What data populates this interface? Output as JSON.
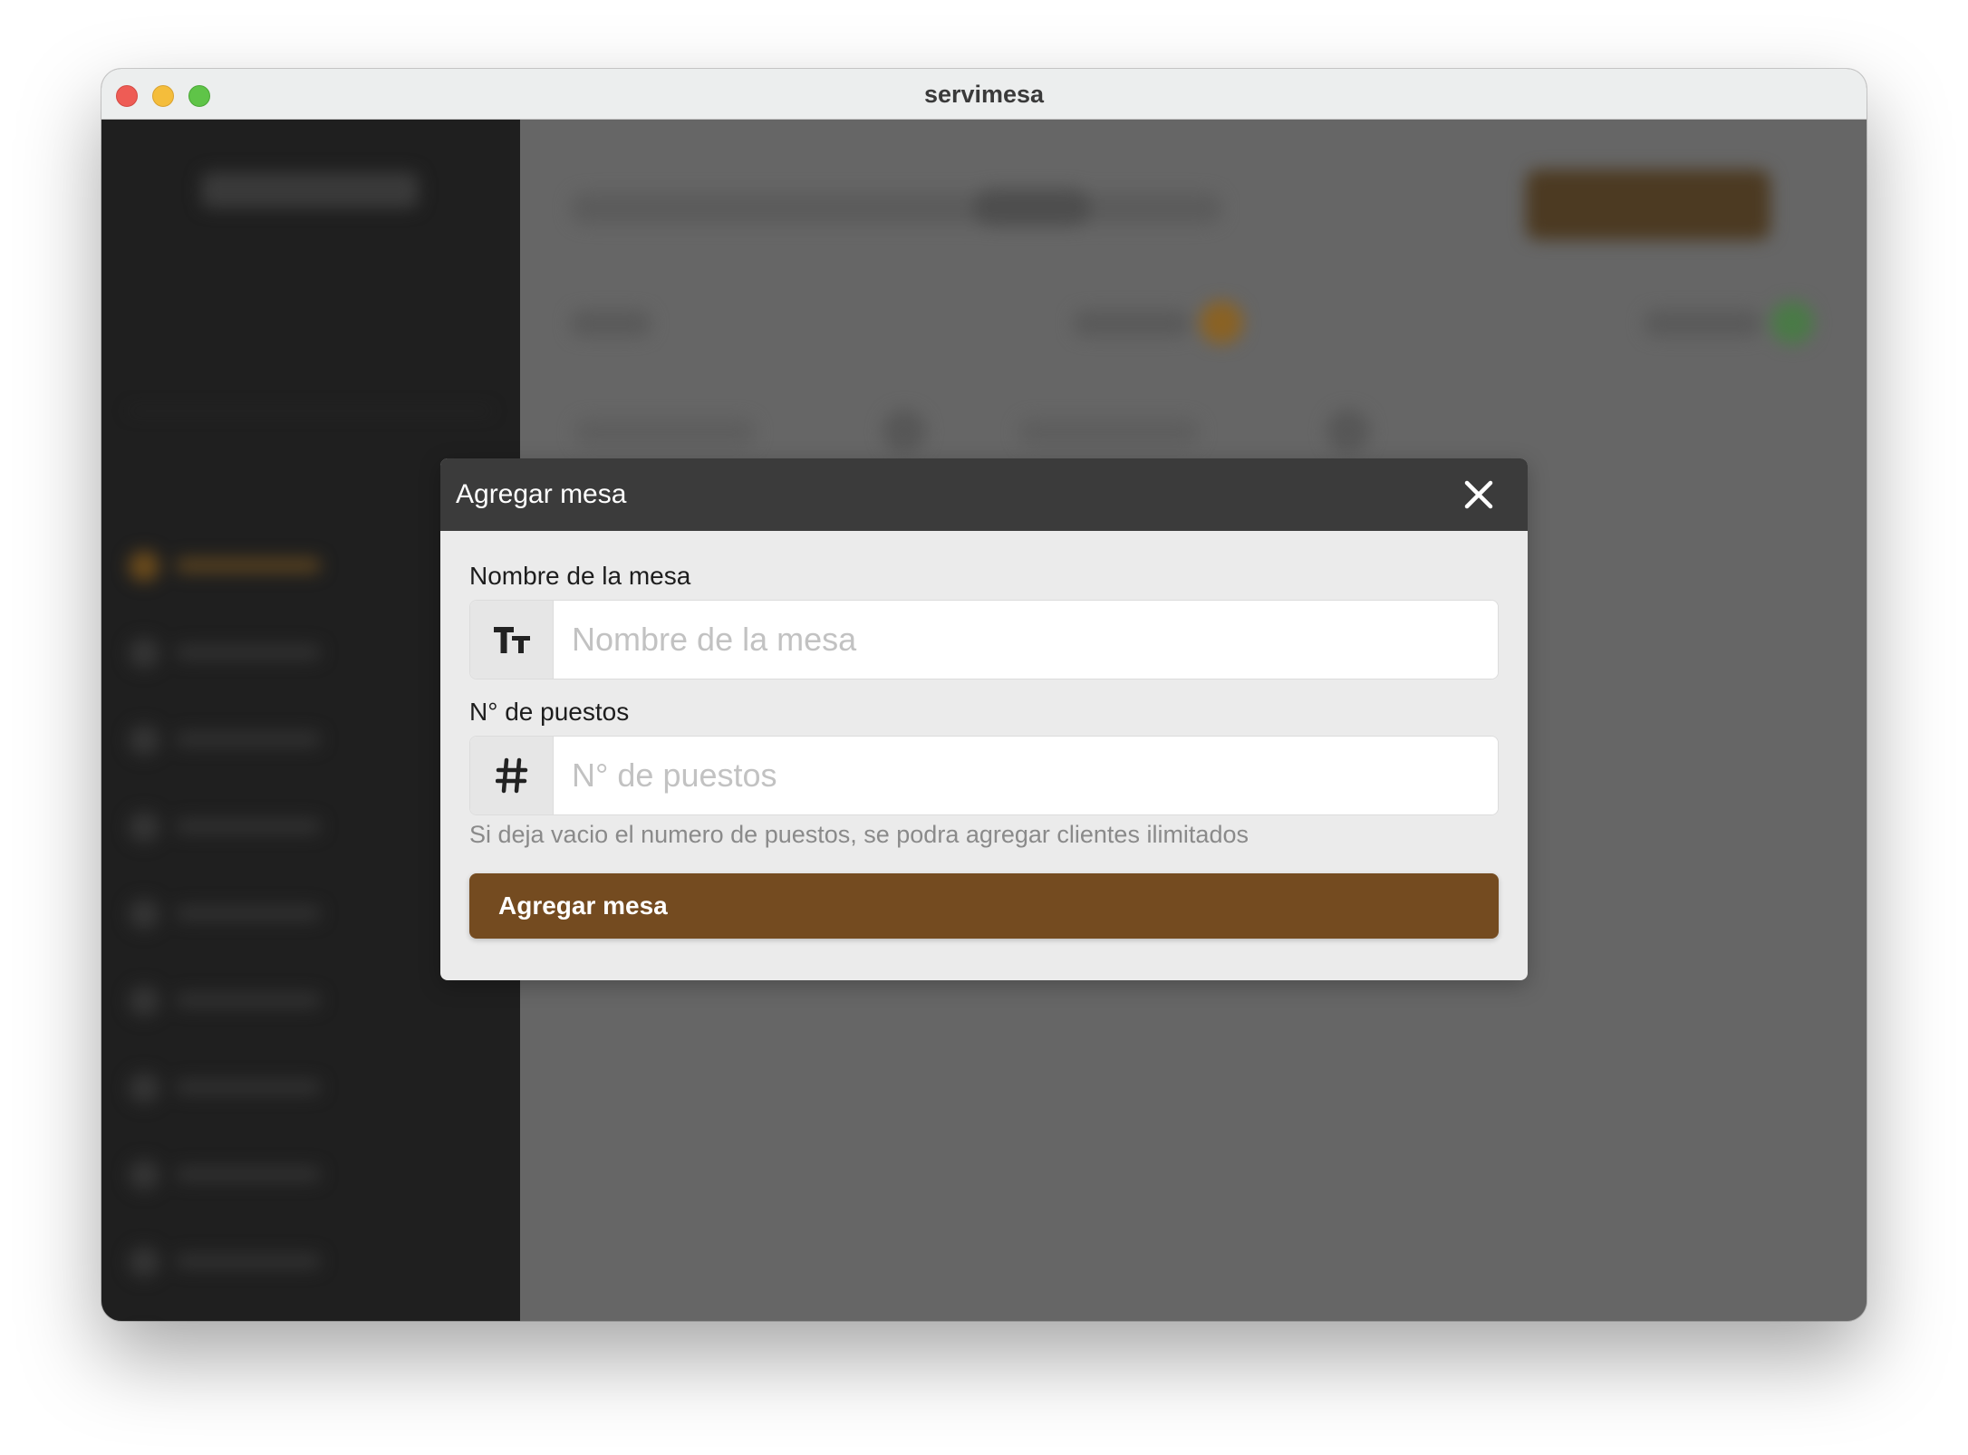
{
  "window": {
    "title": "servimesa"
  },
  "modal": {
    "title": "Agregar mesa",
    "close_icon": "close-icon",
    "fields": [
      {
        "label": "Nombre de la mesa",
        "placeholder": "Nombre de la mesa",
        "value": "",
        "icon": "text-size-icon"
      },
      {
        "label": "N° de puestos",
        "placeholder": "N° de puestos",
        "value": "",
        "icon": "hash-icon"
      }
    ],
    "help_text": "Si deja vacio el numero de puestos, se podra agregar clientes ilimitados",
    "submit_label": "Agregar mesa"
  },
  "colors": {
    "accent": "#744b20",
    "modal_header": "#3b3b3b",
    "sidebar": "#1f1f1f",
    "overlay": "#666666"
  }
}
